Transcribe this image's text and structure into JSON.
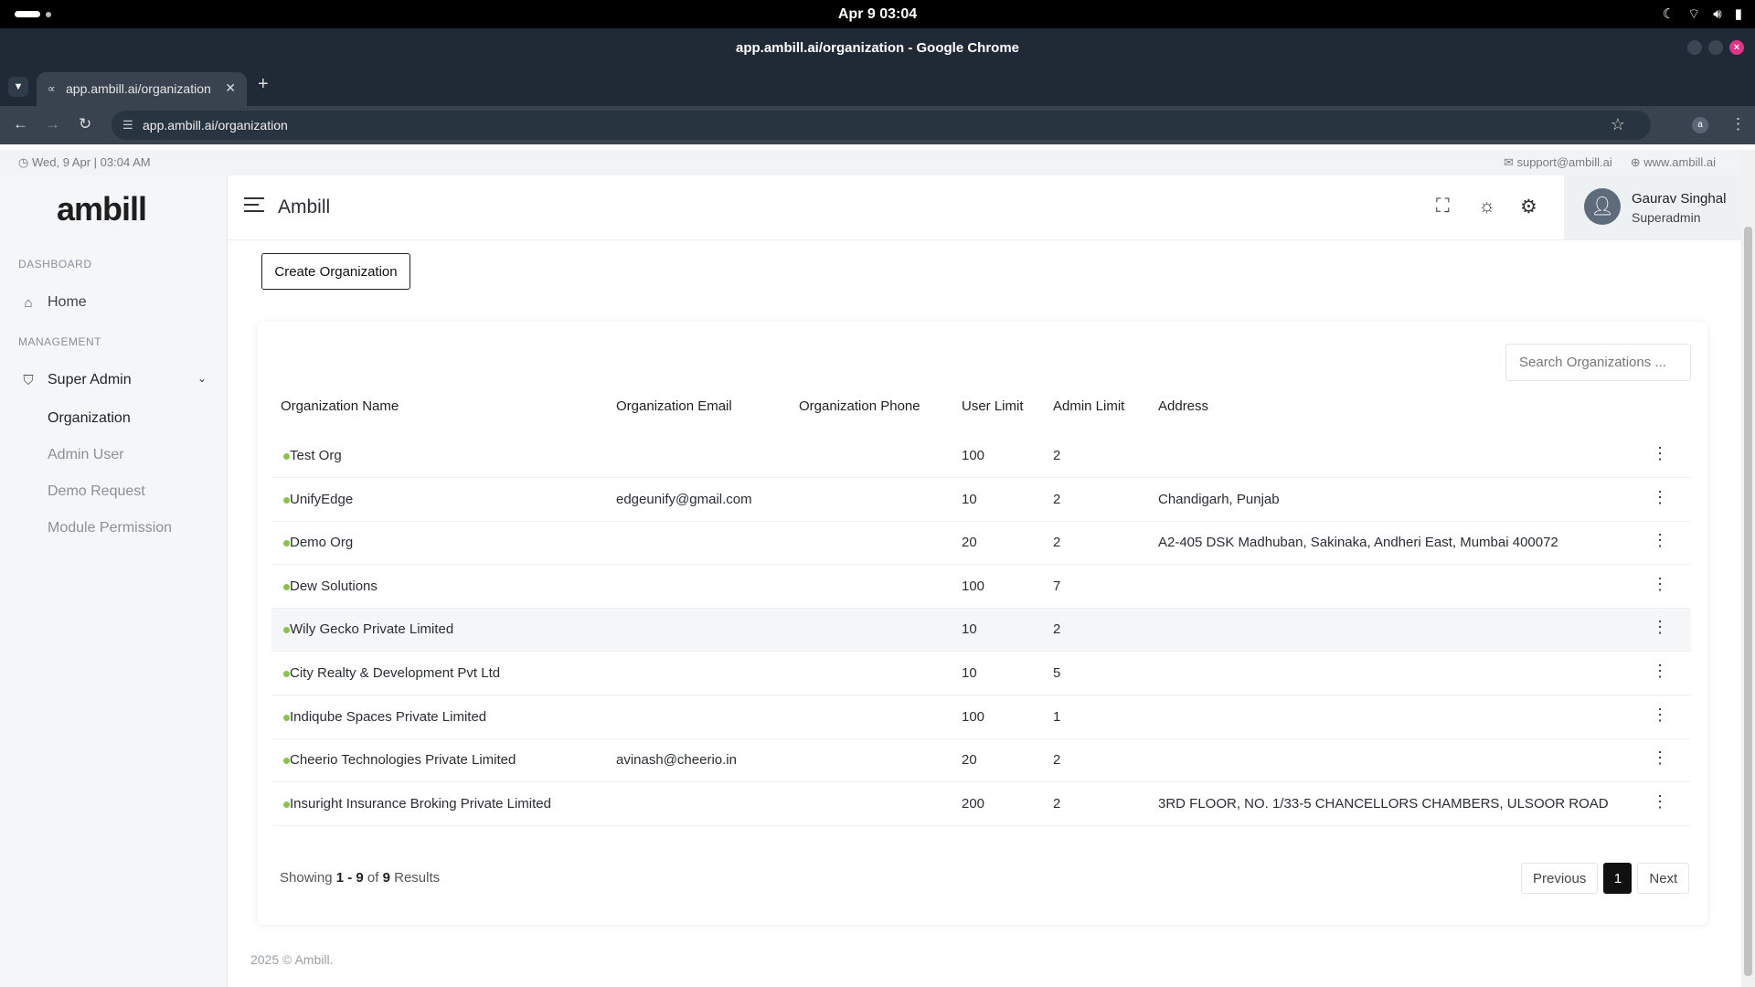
{
  "os": {
    "clock": "Apr 9  03:04"
  },
  "browser": {
    "window_title": "app.ambill.ai/organization - Google Chrome",
    "tab_title": "app.ambill.ai/organization",
    "url": "app.ambill.ai/organization",
    "profile_initial": "a"
  },
  "info_bar": {
    "datetime": "Wed, 9 Apr | 03:04 AM",
    "email": "support@ambill.ai",
    "website": "www.ambill.ai"
  },
  "sidebar": {
    "logo": "ambill",
    "section_dashboard": "DASHBOARD",
    "home": "Home",
    "section_management": "MANAGEMENT",
    "super_admin": "Super Admin",
    "sub_items": [
      "Organization",
      "Admin User",
      "Demo Request",
      "Module Permission"
    ]
  },
  "header": {
    "title": "Ambill",
    "user_name": "Gaurav Singhal",
    "user_role": "Superadmin"
  },
  "main": {
    "create_button": "Create Organization",
    "search_placeholder": "Search Organizations ...",
    "columns": [
      "Organization Name",
      "Organization Email",
      "Organization Phone",
      "User Limit",
      "Admin Limit",
      "Address"
    ],
    "rows": [
      {
        "name": "Test Org",
        "email": "",
        "phone": "",
        "user_limit": "100",
        "admin_limit": "2",
        "address": ""
      },
      {
        "name": "UnifyEdge",
        "email": "edgeunify@gmail.com",
        "phone": "",
        "user_limit": "10",
        "admin_limit": "2",
        "address": "Chandigarh, Punjab"
      },
      {
        "name": "Demo Org",
        "email": "",
        "phone": "",
        "user_limit": "20",
        "admin_limit": "2",
        "address": "A2-405 DSK Madhuban, Sakinaka, Andheri East, Mumbai 400072"
      },
      {
        "name": "Dew Solutions",
        "email": "",
        "phone": "",
        "user_limit": "100",
        "admin_limit": "7",
        "address": ""
      },
      {
        "name": "Wily Gecko Private Limited",
        "email": "",
        "phone": "",
        "user_limit": "10",
        "admin_limit": "2",
        "address": ""
      },
      {
        "name": "City Realty & Development Pvt Ltd",
        "email": "",
        "phone": "",
        "user_limit": "10",
        "admin_limit": "5",
        "address": ""
      },
      {
        "name": "Indiqube Spaces Private Limited",
        "email": "",
        "phone": "",
        "user_limit": "100",
        "admin_limit": "1",
        "address": ""
      },
      {
        "name": "Cheerio Technologies Private Limited",
        "email": "avinash@cheerio.in",
        "phone": "",
        "user_limit": "20",
        "admin_limit": "2",
        "address": ""
      },
      {
        "name": "Insuright Insurance Broking Private Limited",
        "email": "",
        "phone": "",
        "user_limit": "200",
        "admin_limit": "2",
        "address": "3RD FLOOR, NO. 1/33-5 CHANCELLORS CHAMBERS, ULSOOR ROAD"
      }
    ],
    "showing_prefix": "Showing",
    "showing_range": "1 - 9",
    "showing_of": "of",
    "showing_total": "9",
    "showing_suffix": "Results",
    "pager": {
      "previous": "Previous",
      "current": "1",
      "next": "Next"
    }
  },
  "footer": {
    "text": "2025 © Ambill."
  },
  "colors": {
    "status_active": "#8bc34a",
    "chrome_dark": "#1f2a36",
    "sidebar_bg": "#f5f6f8"
  }
}
